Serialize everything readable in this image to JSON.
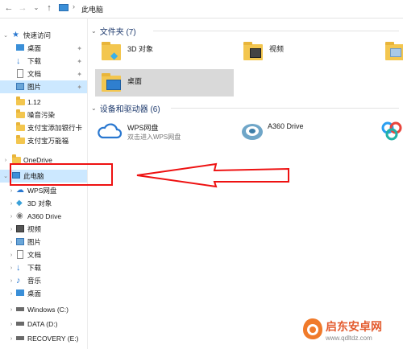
{
  "address": {
    "path": "此电脑",
    "separator": "›"
  },
  "sidebar": {
    "quick_access": "快速访问",
    "quick_items": [
      "桌面",
      "下载",
      "文档",
      "图片",
      "1.12",
      "噪音污染",
      "支付宝添加银行卡",
      "支付宝万能福"
    ],
    "onedrive": "OneDrive",
    "this_pc": "此电脑",
    "pc_items": [
      "WPS网盘",
      "3D 对象",
      "A360 Drive",
      "视频",
      "图片",
      "文档",
      "下载",
      "音乐",
      "桌面",
      "Windows (C:)",
      "DATA (D:)",
      "RECOVERY (E:)"
    ]
  },
  "content": {
    "folders_header": "文件夹 (7)",
    "folders": [
      "3D 对象",
      "视频",
      "桌面"
    ],
    "devices_header": "设备和驱动器 (6)",
    "devices": [
      {
        "name": "WPS网盘",
        "sub": "双击进入WPS网盘"
      },
      {
        "name": "A360 Drive",
        "sub": ""
      }
    ]
  },
  "watermark": {
    "text": "启东安卓网",
    "url": "www.qdltdz.com"
  },
  "colors": {
    "selection": "#cce8ff",
    "folder": "#f3c64f",
    "annotation": "#ee1111",
    "pc_blue": "#3a8fd8"
  }
}
